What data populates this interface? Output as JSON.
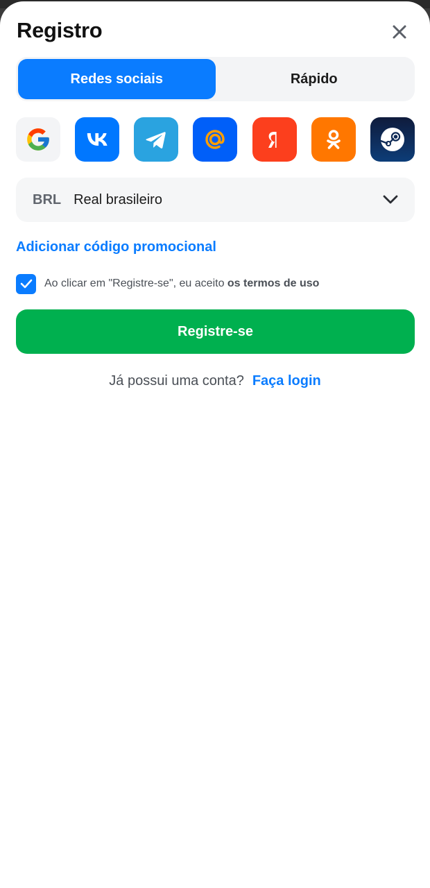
{
  "header": {
    "title": "Registro"
  },
  "tabs": [
    {
      "label": "Redes sociais",
      "active": true
    },
    {
      "label": "Rápido",
      "active": false
    }
  ],
  "socials": [
    {
      "icon": "google-icon",
      "color": "#f3f4f6"
    },
    {
      "icon": "vk-icon",
      "color": "#0077ff"
    },
    {
      "icon": "telegram-icon",
      "color": "#2aa3e0"
    },
    {
      "icon": "mail-ru-icon",
      "color": "#005ff9"
    },
    {
      "icon": "yandex-icon",
      "color": "#fc3f1d"
    },
    {
      "icon": "odnoklassniki-icon",
      "color": "#ff7700"
    },
    {
      "icon": "steam-icon",
      "color": "#0e2a4e"
    }
  ],
  "currency": {
    "code": "BRL",
    "name": "Real brasileiro"
  },
  "promo": {
    "label": "Adicionar código promocional"
  },
  "terms": {
    "checked": true,
    "text": "Ao clicar em \"Registre-se\", eu aceito ",
    "link": "os termos de uso"
  },
  "register": {
    "label": "Registre-se"
  },
  "login": {
    "question": "Já possui uma conta?",
    "link": "Faça login"
  },
  "colors": {
    "accent": "#0a7cff",
    "success": "#00b04f"
  }
}
